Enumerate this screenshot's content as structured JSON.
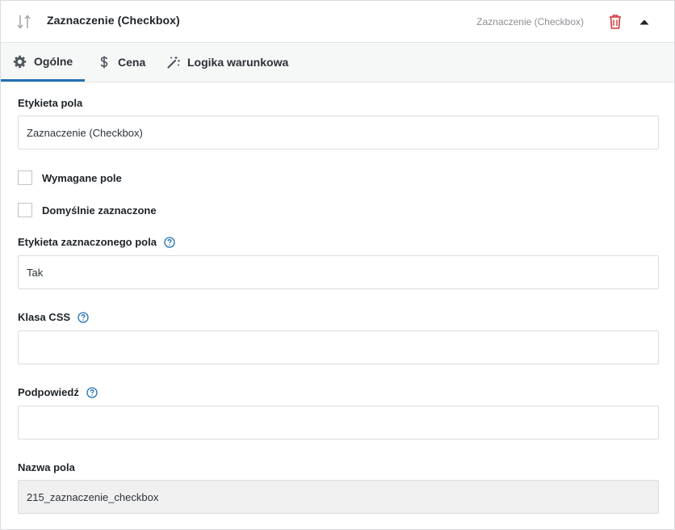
{
  "header": {
    "title": "Zaznaczenie (Checkbox)",
    "type_label": "Zaznaczenie (Checkbox)",
    "icons": {
      "sort": "sort-arrows-icon",
      "delete": "trash-icon",
      "collapse": "caret-up-icon"
    },
    "colors": {
      "delete": "#d63638"
    }
  },
  "tabs": [
    {
      "label": "Ogólne",
      "icon": "gear-icon",
      "active": true
    },
    {
      "label": "Cena",
      "icon": "dollar-icon",
      "active": false
    },
    {
      "label": "Logika warunkowa",
      "icon": "magic-wand-icon",
      "active": false
    }
  ],
  "accent_color": "#2271b1",
  "form": {
    "field_label": {
      "label": "Etykieta pola",
      "value": "Zaznaczenie (Checkbox)"
    },
    "required": {
      "label": "Wymagane pole",
      "checked": false
    },
    "default_checked": {
      "label": "Domyślnie zaznaczone",
      "checked": false
    },
    "checked_label": {
      "label": "Etykieta zaznaczonego pola",
      "value": "Tak",
      "help_icon": "help-circle-icon"
    },
    "css_class": {
      "label": "Klasa CSS",
      "value": "",
      "help_icon": "help-circle-icon"
    },
    "tooltip": {
      "label": "Podpowiedź",
      "value": "",
      "help_icon": "help-circle-icon"
    },
    "field_name": {
      "label": "Nazwa pola",
      "value": "215_zaznaczenie_checkbox",
      "readonly": true
    }
  }
}
